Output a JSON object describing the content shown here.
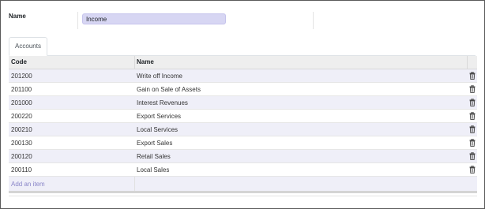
{
  "form": {
    "name_label": "Name",
    "name_value": "Income"
  },
  "tabs": [
    {
      "label": "Accounts"
    }
  ],
  "table": {
    "headers": {
      "code": "Code",
      "name": "Name"
    },
    "rows": [
      {
        "code": "201200",
        "name": "Write off Income"
      },
      {
        "code": "201100",
        "name": "Gain on Sale of Assets"
      },
      {
        "code": "201000",
        "name": "Interest Revenues"
      },
      {
        "code": "200220",
        "name": "Export Services"
      },
      {
        "code": "200210",
        "name": "Local Services"
      },
      {
        "code": "200130",
        "name": "Export Sales"
      },
      {
        "code": "200120",
        "name": "Retail Sales"
      },
      {
        "code": "200110",
        "name": "Local Sales"
      }
    ],
    "row_action_icon": "trash-icon",
    "add_item_label": "Add an item"
  },
  "colors": {
    "accent": "#8a86c8",
    "input_bg": "#d7d6f3",
    "row_stripe": "#efeff8"
  }
}
